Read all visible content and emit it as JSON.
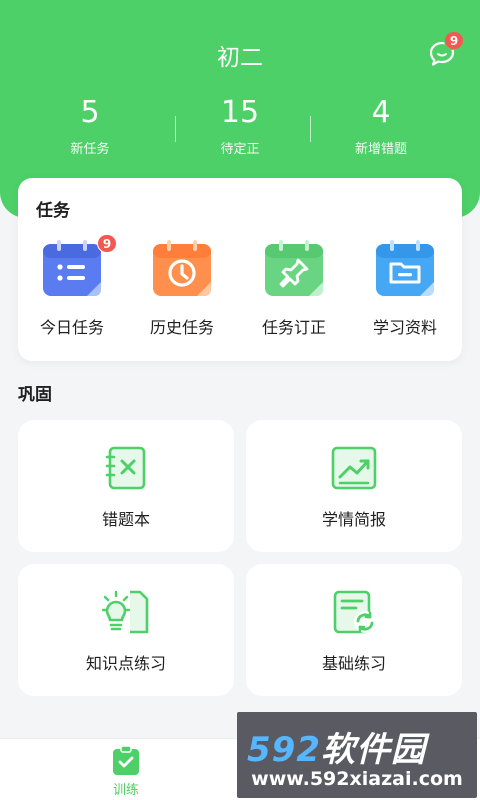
{
  "header": {
    "grade": "初二",
    "message_badge": "9",
    "stats": [
      {
        "value": "5",
        "label": "新任务"
      },
      {
        "value": "15",
        "label": "待定正"
      },
      {
        "value": "4",
        "label": "新增错题"
      }
    ]
  },
  "tasks": {
    "title": "任务",
    "items": [
      {
        "label": "今日任务",
        "badge": "9",
        "icon": "calendar-list-icon",
        "color": "#5b7cf0"
      },
      {
        "label": "历史任务",
        "icon": "history-clock-icon",
        "color": "#ff8f4d"
      },
      {
        "label": "任务订正",
        "icon": "pin-icon",
        "color": "#5dd07a"
      },
      {
        "label": "学习资料",
        "icon": "folder-icon",
        "color": "#46a8f5"
      }
    ]
  },
  "consolidate": {
    "title": "巩固",
    "tiles": [
      {
        "label": "错题本",
        "icon": "wrong-notebook-icon"
      },
      {
        "label": "学情简报",
        "icon": "trend-chart-icon"
      },
      {
        "label": "知识点练习",
        "icon": "lightbulb-icon"
      },
      {
        "label": "基础练习",
        "icon": "refresh-doc-icon"
      }
    ]
  },
  "tabbar": {
    "active": {
      "label": "训练",
      "icon": "clipboard-check-icon"
    }
  },
  "watermark": {
    "digits": "592",
    "brand_text": "软件园",
    "url": "www.592xiazai.com"
  },
  "colors": {
    "primary": "#4dd068",
    "badge": "#f25a51"
  }
}
